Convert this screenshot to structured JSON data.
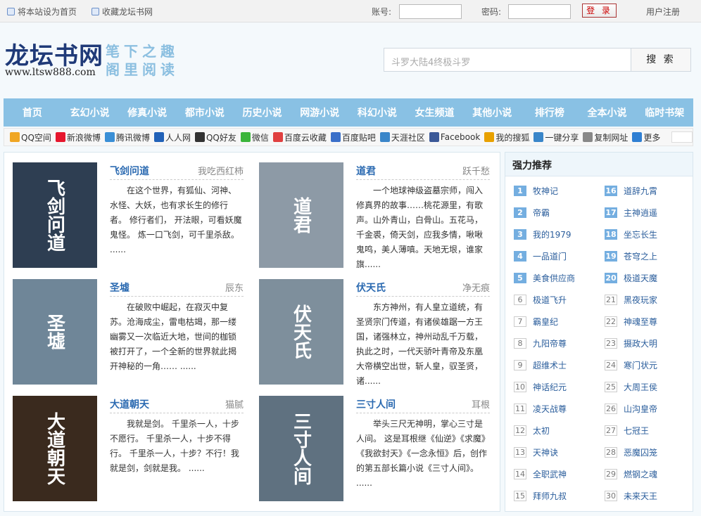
{
  "topbar": {
    "set_home": "将本站设为首页",
    "bookmark": "收藏龙坛书网",
    "account_label": "账号:",
    "password_label": "密码:",
    "login": "登 录",
    "register": "用户注册"
  },
  "header": {
    "logo": "龙坛书网",
    "url": "www.ltsw888.com",
    "slogan_line1": "笔下之趣",
    "slogan_line2": "阁里阅读",
    "search_placeholder": "斗罗大陆4终极斗罗",
    "search_button": "搜 索"
  },
  "nav": [
    "首页",
    "玄幻小说",
    "修真小说",
    "都市小说",
    "历史小说",
    "网游小说",
    "科幻小说",
    "女生频道",
    "其他小说",
    "排行榜",
    "全本小说",
    "临时书架"
  ],
  "share": [
    {
      "label": "QQ空间",
      "icon": "qzone-icon",
      "color": "#f0a623"
    },
    {
      "label": "新浪微博",
      "icon": "weibo-icon",
      "color": "#e6162d"
    },
    {
      "label": "腾讯微博",
      "icon": "tencent-weibo-icon",
      "color": "#3a8fd6"
    },
    {
      "label": "人人网",
      "icon": "renren-icon",
      "color": "#2262b8"
    },
    {
      "label": "QQ好友",
      "icon": "qq-icon",
      "color": "#333333"
    },
    {
      "label": "微信",
      "icon": "wechat-icon",
      "color": "#3bb53b"
    },
    {
      "label": "百度云收藏",
      "icon": "heart-icon",
      "color": "#e04040"
    },
    {
      "label": "百度贴吧",
      "icon": "tieba-icon",
      "color": "#3a6fc9"
    },
    {
      "label": "天涯社区",
      "icon": "tianya-icon",
      "color": "#3a86c9"
    },
    {
      "label": "Facebook",
      "icon": "facebook-icon",
      "color": "#3b5998"
    },
    {
      "label": "我的搜狐",
      "icon": "sohu-icon",
      "color": "#e8a100"
    },
    {
      "label": "一键分享",
      "icon": "share-icon",
      "color": "#3a86c9"
    },
    {
      "label": "复制网址",
      "icon": "copy-icon",
      "color": "#888888"
    },
    {
      "label": "更多",
      "icon": "plus-icon",
      "color": "#2f7fd3"
    }
  ],
  "books": [
    {
      "title": "飞剑问道",
      "author": "我吃西红柿",
      "cover_text": "飞剑问道",
      "cover_color": "#2e3e52",
      "desc": "在这个世界，有狐仙、河神、水怪、大妖，也有求长生的修行者。 修行者们， 开法眼，可看妖魔鬼怪。 炼一口飞剑，可千里杀敌。 ......"
    },
    {
      "title": "道君",
      "author": "跃千愁",
      "cover_text": "道君",
      "cover_color": "#8d9aa6",
      "desc": "一个地球神级盗墓宗师，闯入修真界的故事……桃花源里，有歌声。山外青山，白骨山。五花马，千金裘，倚天剑，应我多情，啾啾鬼鸣，美人薄嗔。天地无垠，谁家旗......"
    },
    {
      "title": "圣墟",
      "author": "辰东",
      "cover_text": "圣墟",
      "cover_color": "#6f8698",
      "desc": "在破败中崛起，在寂灭中复苏。沧海成尘，雷电枯竭，那一缕幽雾又一次临近大地，世间的枷锁被打开了，一个全新的世界就此揭开神秘的一角…… ......"
    },
    {
      "title": "伏天氏",
      "author": "净无痕",
      "cover_text": "伏天氏",
      "cover_color": "#7e8f9c",
      "desc": "东方神州，有人皇立道统，有圣贤宗门传道，有诸侯雄踞一方王国，诸强林立，神州动乱千万载，执此之时，一代天骄叶青帝及东凰大帝横空出世，斩人皇，驭圣贤，诸......"
    },
    {
      "title": "大道朝天",
      "author": "猫腻",
      "cover_text": "大道朝天",
      "cover_color": "#3a2a1e",
      "desc": "我就是剑。 千里杀一人，十步不愿行。 千里杀一人，十步不得行。 千里杀一人，十步？不行！我就是剑，剑就是我。 ......"
    },
    {
      "title": "三寸人间",
      "author": "耳根",
      "cover_text": "三寸人间",
      "cover_color": "#5f7180",
      "desc": "举头三尺无神明，掌心三寸是人间。 这是耳根继《仙逆》《求魔》《我欲封天》《一念永恒》后，创作的第五部长篇小说《三寸人间》。 ......"
    }
  ],
  "sidebar": {
    "title": "强力推荐",
    "ranks": [
      {
        "num": "1",
        "name": "牧神记"
      },
      {
        "num": "16",
        "name": "道辞九霄"
      },
      {
        "num": "2",
        "name": "帝霸"
      },
      {
        "num": "17",
        "name": "主神逍遥"
      },
      {
        "num": "3",
        "name": "我的1979"
      },
      {
        "num": "18",
        "name": "坐忘长生"
      },
      {
        "num": "4",
        "name": "一品道门"
      },
      {
        "num": "19",
        "name": "苍穹之上"
      },
      {
        "num": "5",
        "name": "美食供应商"
      },
      {
        "num": "20",
        "name": "极道天魔"
      },
      {
        "num": "6",
        "name": "极道飞升"
      },
      {
        "num": "21",
        "name": "黑夜玩家"
      },
      {
        "num": "7",
        "name": "霸皇纪"
      },
      {
        "num": "22",
        "name": "神魂至尊"
      },
      {
        "num": "8",
        "name": "九阳帝尊"
      },
      {
        "num": "23",
        "name": "摄政大明"
      },
      {
        "num": "9",
        "name": "超维术士"
      },
      {
        "num": "24",
        "name": "寒门状元"
      },
      {
        "num": "10",
        "name": "神话纪元"
      },
      {
        "num": "25",
        "name": "大周王侯"
      },
      {
        "num": "11",
        "name": "凌天战尊"
      },
      {
        "num": "26",
        "name": "山沟皇帝"
      },
      {
        "num": "12",
        "name": "太初"
      },
      {
        "num": "27",
        "name": "七冠王"
      },
      {
        "num": "13",
        "name": "天神诀"
      },
      {
        "num": "28",
        "name": "恶魔囚笼"
      },
      {
        "num": "14",
        "name": "全职武神"
      },
      {
        "num": "29",
        "name": "燃钢之魂"
      },
      {
        "num": "15",
        "name": "拜师九叔"
      },
      {
        "num": "30",
        "name": "未来天王"
      }
    ]
  }
}
